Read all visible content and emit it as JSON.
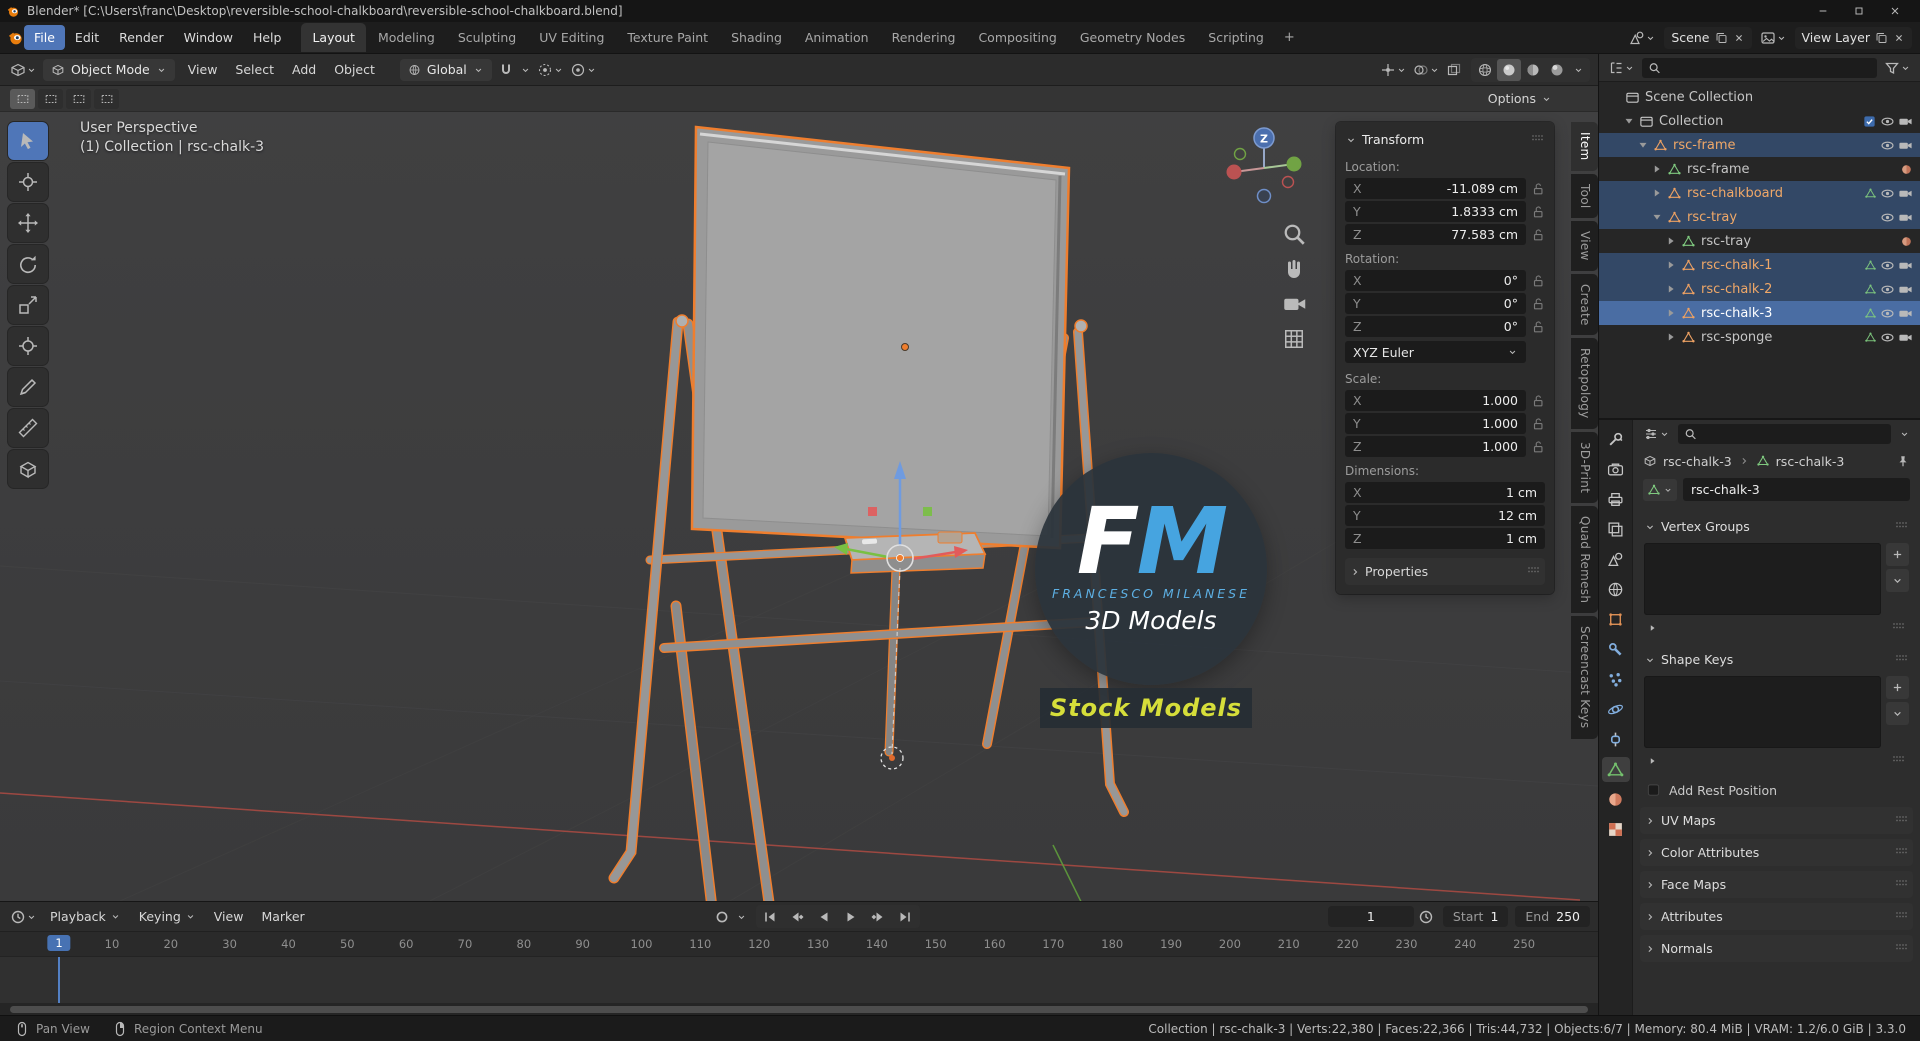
{
  "titlebar": {
    "title": "Blender* [C:\\Users\\franc\\Desktop\\reversible-school-chalkboard\\reversible-school-chalkboard.blend]"
  },
  "menubar": {
    "menus": [
      "File",
      "Edit",
      "Render",
      "Window",
      "Help"
    ],
    "active_menu": "File",
    "workspaces": [
      "Layout",
      "Modeling",
      "Sculpting",
      "UV Editing",
      "Texture Paint",
      "Shading",
      "Animation",
      "Rendering",
      "Compositing",
      "Geometry Nodes",
      "Scripting"
    ],
    "active_workspace": "Layout",
    "add_workspace": "+",
    "scene_name": "Scene",
    "view_layer_name": "View Layer"
  },
  "viewport_header": {
    "mode": "Object Mode",
    "menus": [
      "View",
      "Select",
      "Add",
      "Object"
    ],
    "orientation": "Global",
    "options_label": "Options"
  },
  "viewport": {
    "perspective_label": "User Perspective",
    "collection_label": "(1) Collection | rsc-chalk-3",
    "gizmo_axis_label": "Z"
  },
  "watermark": {
    "initial_f": "F",
    "initial_m": "M",
    "name": "FRANCESCO MILANESE",
    "tagline": "3D Models",
    "badge": "Stock Models"
  },
  "npanel": {
    "title": "Transform",
    "tabs": [
      {
        "label": "Item",
        "active": true
      },
      {
        "label": "Tool"
      },
      {
        "label": "View"
      },
      {
        "label": "Create"
      },
      {
        "label": "Retopology"
      },
      {
        "label": "3D-Print"
      },
      {
        "label": "Quad Remesh"
      },
      {
        "label": "Screencast Keys"
      }
    ],
    "location_label": "Location:",
    "rows_location": [
      {
        "axis": "X",
        "value": "-11.089 cm"
      },
      {
        "axis": "Y",
        "value": "1.8333 cm"
      },
      {
        "axis": "Z",
        "value": "77.583 cm"
      }
    ],
    "rotation_label": "Rotation:",
    "rows_rotation": [
      {
        "axis": "X",
        "value": "0°"
      },
      {
        "axis": "Y",
        "value": "0°"
      },
      {
        "axis": "Z",
        "value": "0°"
      }
    ],
    "euler_mode": "XYZ Euler",
    "scale_label": "Scale:",
    "rows_scale": [
      {
        "axis": "X",
        "value": "1.000"
      },
      {
        "axis": "Y",
        "value": "1.000"
      },
      {
        "axis": "Z",
        "value": "1.000"
      }
    ],
    "dimensions_label": "Dimensions:",
    "rows_dimensions": [
      {
        "axis": "X",
        "value": "1 cm"
      },
      {
        "axis": "Y",
        "value": "12 cm"
      },
      {
        "axis": "Z",
        "value": "1 cm"
      }
    ],
    "properties_label": "Properties"
  },
  "outliner": {
    "items": [
      {
        "label": "Scene Collection",
        "depth": 0,
        "icon": "collection-scene",
        "arrow": ""
      },
      {
        "label": "Collection",
        "depth": 1,
        "icon": "collection",
        "arrow": "down",
        "right": "checkbox"
      },
      {
        "label": "rsc-frame",
        "depth": 2,
        "icon": "mesh-object",
        "arrow": "down",
        "selected": true,
        "badges": []
      },
      {
        "label": "rsc-frame",
        "depth": 3,
        "icon": "mesh-data",
        "arrow": "right",
        "badges": [
          "material"
        ]
      },
      {
        "label": "rsc-chalkboard",
        "depth": 3,
        "icon": "mesh-object",
        "arrow": "right",
        "selected": true,
        "badges": [
          "mesh"
        ]
      },
      {
        "label": "rsc-tray",
        "depth": 3,
        "icon": "mesh-object",
        "arrow": "down",
        "selected": true,
        "badges": []
      },
      {
        "label": "rsc-tray",
        "depth": 4,
        "icon": "mesh-data",
        "arrow": "right",
        "badges": [
          "material"
        ]
      },
      {
        "label": "rsc-chalk-1",
        "depth": 4,
        "icon": "mesh-object",
        "arrow": "right",
        "selected": true,
        "badges": [
          "mesh"
        ]
      },
      {
        "label": "rsc-chalk-2",
        "depth": 4,
        "icon": "mesh-object",
        "arrow": "right",
        "selected": true,
        "badges": [
          "mesh"
        ]
      },
      {
        "label": "rsc-chalk-3",
        "depth": 4,
        "icon": "mesh-object",
        "arrow": "right",
        "selected": true,
        "active": true,
        "badges": [
          "mesh"
        ]
      },
      {
        "label": "rsc-sponge",
        "depth": 4,
        "icon": "mesh-object",
        "arrow": "right",
        "badges": [
          "mesh"
        ]
      }
    ]
  },
  "properties": {
    "breadcrumb": [
      "rsc-chalk-3",
      "rsc-chalk-3"
    ],
    "name_value": "rsc-chalk-3",
    "tabs": [
      "tool",
      "render",
      "output",
      "view-layer",
      "scene",
      "world",
      "object",
      "modifiers",
      "particles",
      "physics",
      "constraints",
      "data",
      "material",
      "texture"
    ],
    "active_tab": "data",
    "panels": {
      "vertex_groups": "Vertex Groups",
      "shape_keys": "Shape Keys",
      "add_rest_position": "Add Rest Position",
      "collapsed": [
        "UV Maps",
        "Color Attributes",
        "Face Maps",
        "Attributes",
        "Normals"
      ]
    }
  },
  "timeline": {
    "menus": [
      "Playback",
      "Keying",
      "View",
      "Marker"
    ],
    "current_frame": "1",
    "start_label": "Start",
    "start_value": "1",
    "end_label": "End",
    "end_value": "250",
    "ticks": [
      1,
      10,
      20,
      30,
      40,
      50,
      60,
      70,
      80,
      90,
      100,
      110,
      120,
      130,
      140,
      150,
      160,
      170,
      180,
      190,
      200,
      210,
      220,
      230,
      240,
      250
    ]
  },
  "statusbar": {
    "hints": [
      {
        "label": "Pan View"
      },
      {
        "label": "Region Context Menu"
      }
    ],
    "stats": "Collection | rsc-chalk-3 | Verts:22,380 | Faces:22,366 | Tris:44,732 | Objects:6/7 | Memory: 80.4 MiB | VRAM: 1.2/6.0 GiB | 3.3.0"
  },
  "colors": {
    "accent_blue": "#4772b3",
    "selection_orange": "#ef7e2e",
    "logo_blue": "#46a4e0",
    "badge_yellow": "#d6de3a"
  }
}
